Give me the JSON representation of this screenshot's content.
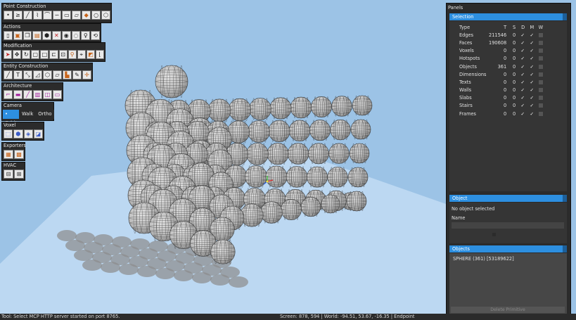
{
  "toolbars": {
    "point_construction": {
      "title": "Point Construction"
    },
    "actions": {
      "title": "Actions"
    },
    "modification": {
      "title": "Modification"
    },
    "entity_construction": {
      "title": "Entity Construction"
    },
    "architecture": {
      "title": "Architecture"
    },
    "camera": {
      "title": "Camera",
      "orbit": "• Orbit",
      "walk": "Walk",
      "ortho": "Ortho",
      "active": "orbit"
    },
    "voxel": {
      "title": "Voxel"
    },
    "exporters": {
      "title": "Exporters"
    },
    "hvac": {
      "title": "HVAC"
    }
  },
  "panels": {
    "title": "Panels",
    "selection": {
      "title": "Selection",
      "headers": [
        "Type",
        "T",
        "S",
        "D",
        "M",
        "W"
      ],
      "rows": [
        {
          "type": "Edges",
          "t": "211546",
          "s": "0"
        },
        {
          "type": "Faces",
          "t": "190608",
          "s": "0"
        },
        {
          "type": "Voxels",
          "t": "0",
          "s": "0"
        },
        {
          "type": "Hotspots",
          "t": "0",
          "s": "0"
        },
        {
          "type": "Objects",
          "t": "361",
          "s": "0"
        },
        {
          "type": "Dimensions",
          "t": "0",
          "s": "0"
        },
        {
          "type": "Texts",
          "t": "0",
          "s": "0"
        },
        {
          "type": "Walls",
          "t": "0",
          "s": "0"
        },
        {
          "type": "Slabs",
          "t": "0",
          "s": "0"
        },
        {
          "type": "Stairs",
          "t": "0",
          "s": "0"
        },
        {
          "type": "Frames",
          "t": "0",
          "s": "0"
        }
      ]
    },
    "object": {
      "title": "Object",
      "status": "No object selected",
      "name_label": "Name",
      "name_value": ""
    },
    "objects": {
      "title": "Objects",
      "items": [
        "SPHERE (361) [53189622]"
      ],
      "delete_label": "Delete Primitive"
    }
  },
  "statusbar": {
    "left": "Tool: Select MCP HTTP server started on port 8765.",
    "right": "Screen: 878, 594 | World: -94.51, 53.67, -16.35 | Endpoint"
  },
  "colors": {
    "sky": "#9cc3e6",
    "ground": "#bcd8f2",
    "accent": "#2d8fe0",
    "panel_bg": "#2b2b2b"
  }
}
